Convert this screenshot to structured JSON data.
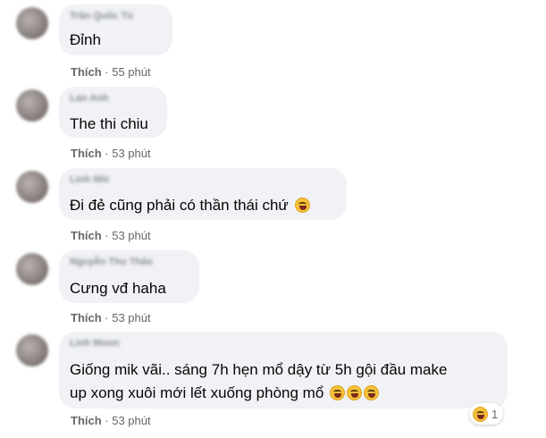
{
  "comments": [
    {
      "author": "Trần Quốc Tú",
      "text": "Đỉnh",
      "like": "Thích",
      "sep": " · ",
      "time": "55 phút"
    },
    {
      "author": "Lan Anh",
      "text": "The thi chiu",
      "like": "Thích",
      "sep": " · ",
      "time": "53 phút"
    },
    {
      "author": "Linh Nhi",
      "text": "Đi đẻ cũng phải có thần thái chứ",
      "emoji": "laughing-tears-icon",
      "like": "Thích",
      "sep": " · ",
      "time": "53 phút"
    },
    {
      "author": "Nguyễn Thu Thảo",
      "text": "Cưng vđ haha",
      "like": "Thích",
      "sep": " · ",
      "time": "53 phút"
    },
    {
      "author": "Linh Moon",
      "text_line1": "Giống mik vãi.. sáng 7h hẹn mổ dậy từ 5h gội đầu make",
      "text_line2": "up xong xuôi mới lết xuống phòng mổ",
      "emojis": [
        "rolling-laughing-icon",
        "rolling-laughing-icon",
        "rolling-laughing-icon"
      ],
      "like": "Thích",
      "sep": " · ",
      "time": "53 phút",
      "reaction_count": "1",
      "reaction_emoji": "laughing-tears-icon"
    }
  ],
  "colors": {
    "bubble": "#f0f2f5",
    "meta": "#65676b",
    "text": "#050505"
  }
}
